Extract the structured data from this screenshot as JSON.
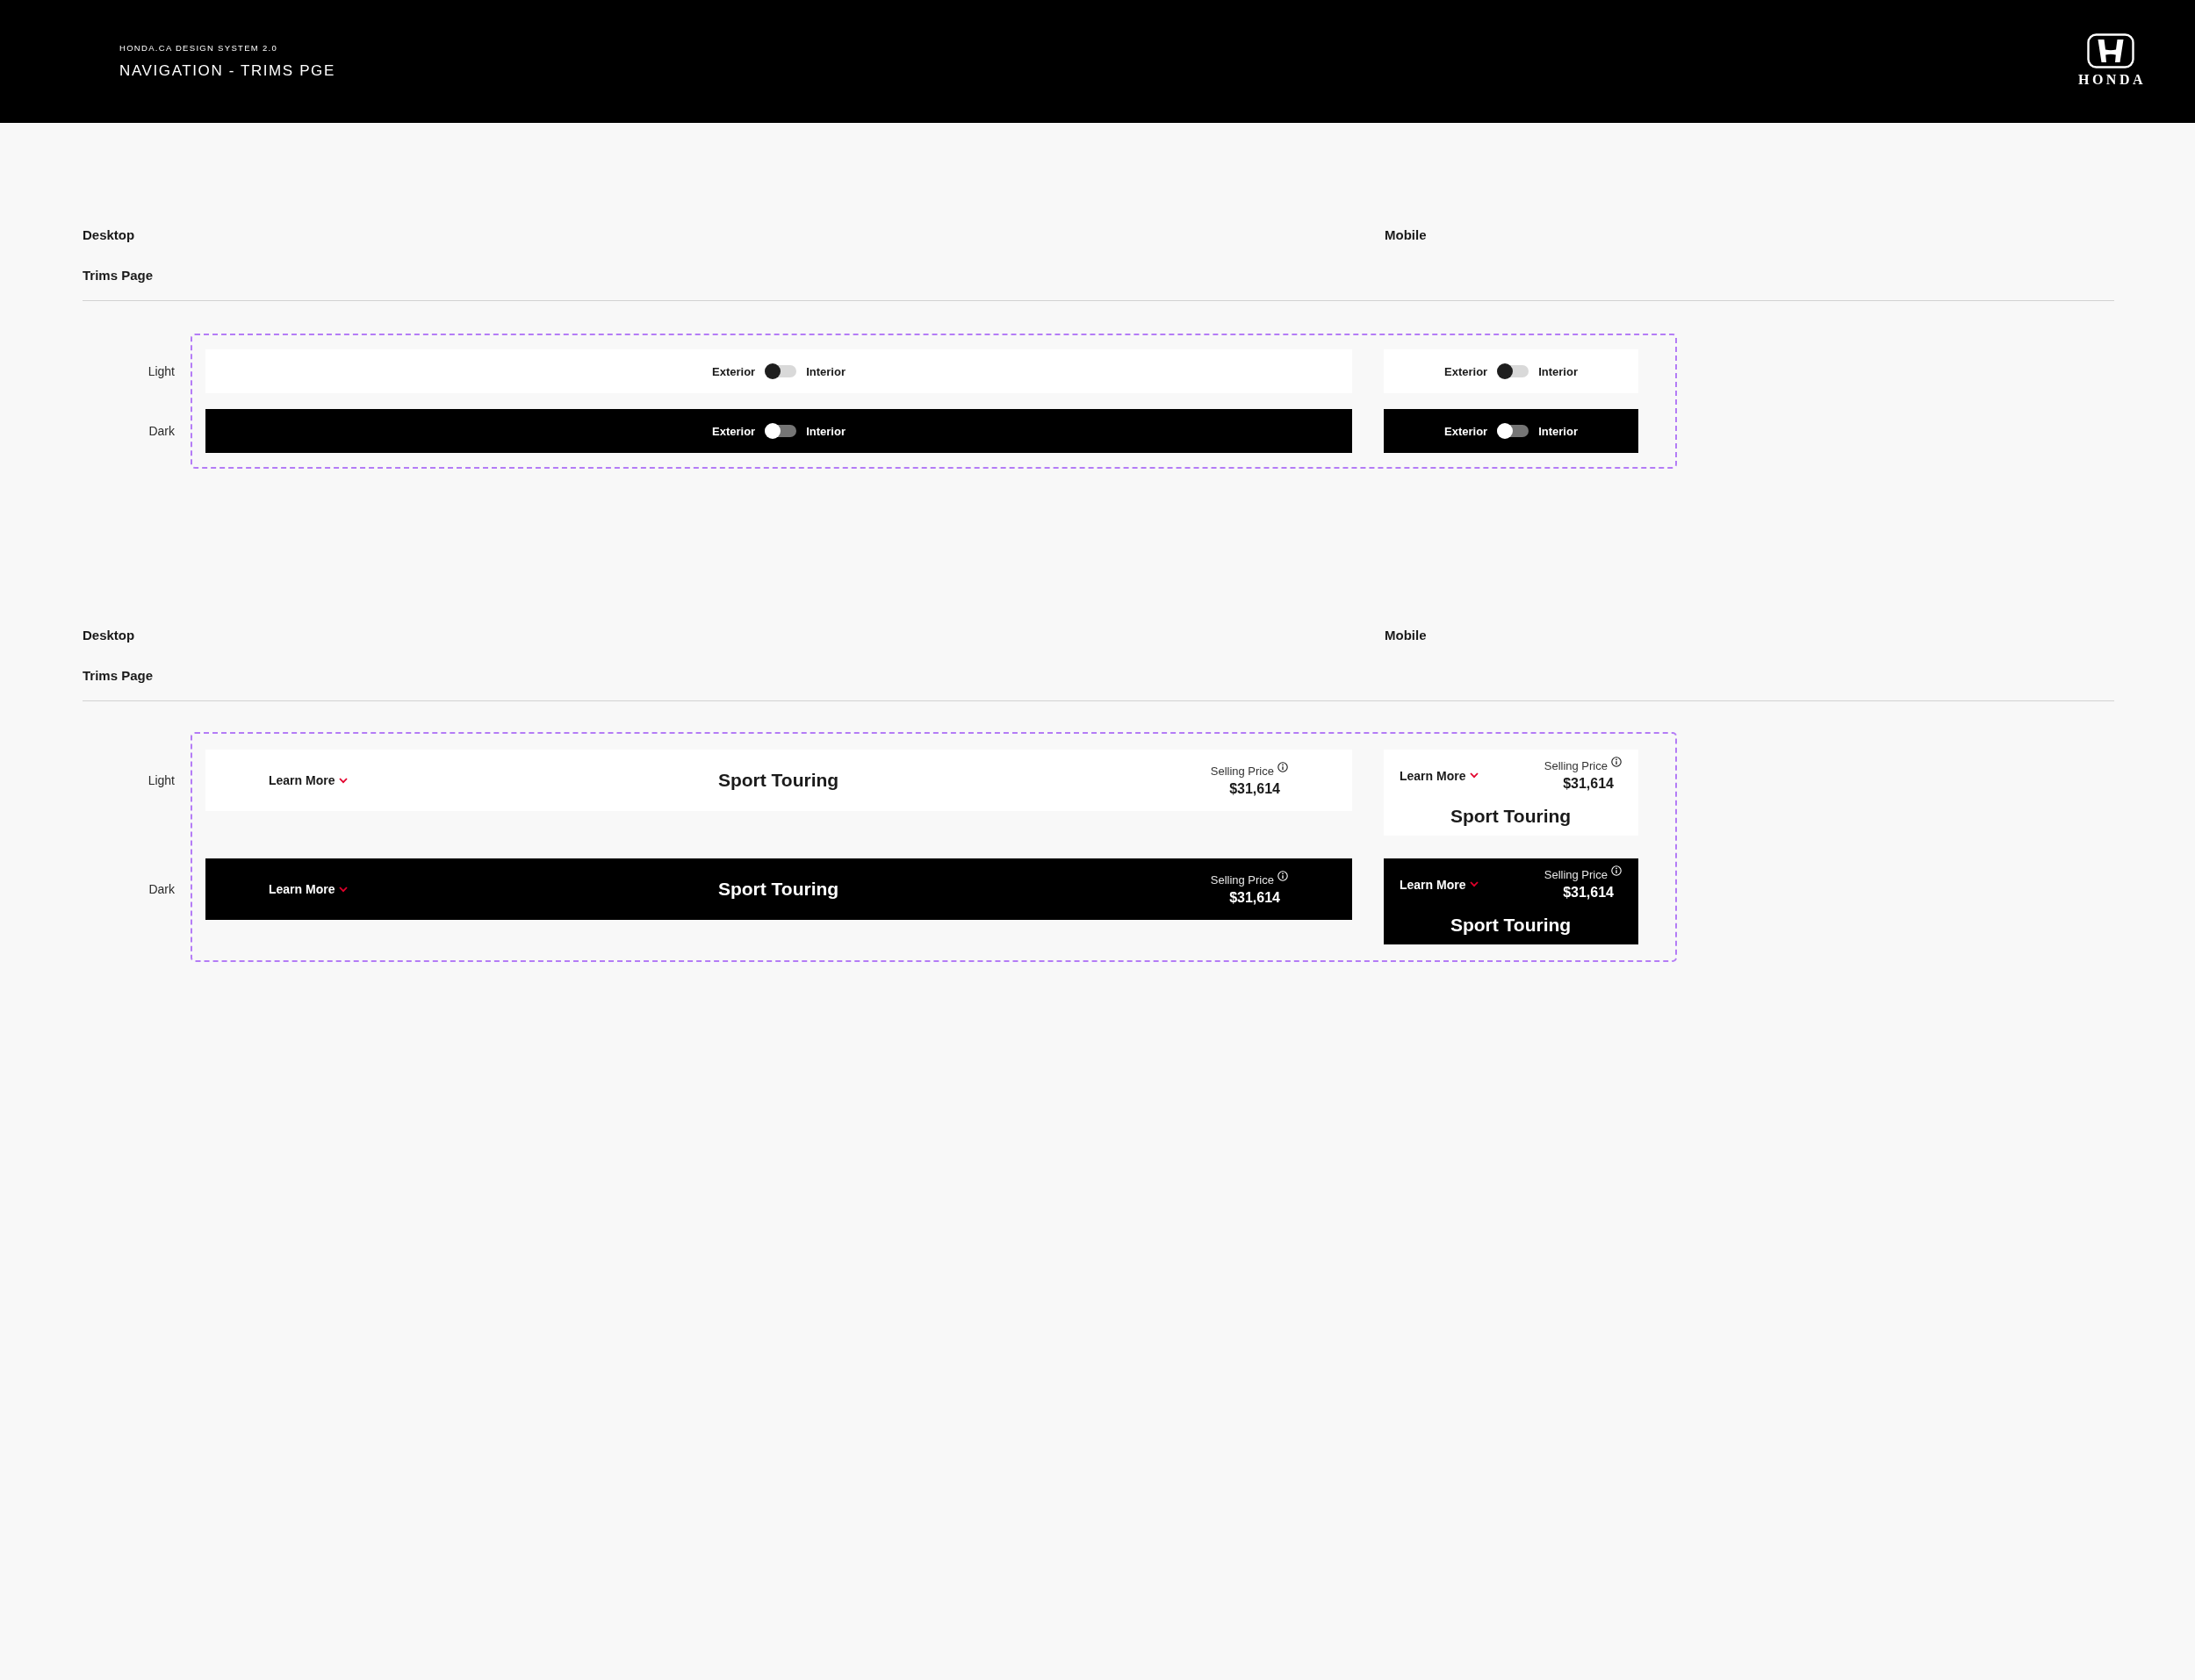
{
  "header": {
    "eyebrow": "HONDA.CA DESIGN SYSTEM 2.0",
    "title": "NAVIGATION - TRIMS PGE",
    "logo_text": "HONDA"
  },
  "sections": [
    {
      "kind": "toggle",
      "desktop_label": "Desktop",
      "mobile_label": "Mobile",
      "page_label": "Trims Page",
      "variants": [
        {
          "label": "Light",
          "kind": "light",
          "desktop": {
            "left": "Exterior",
            "right": "Interior",
            "on": false
          },
          "mobile": {
            "left": "Exterior",
            "right": "Interior",
            "on": false
          }
        },
        {
          "label": "Dark",
          "kind": "dark",
          "desktop": {
            "left": "Exterior",
            "right": "Interior",
            "on": false
          },
          "mobile": {
            "left": "Exterior",
            "right": "Interior",
            "on": false
          }
        }
      ]
    },
    {
      "kind": "trim",
      "desktop_label": "Desktop",
      "mobile_label": "Mobile",
      "page_label": "Trims Page",
      "variants": [
        {
          "label": "Light",
          "kind": "light",
          "desktop": {
            "link": "Learn More",
            "trim": "Sport Touring",
            "price_label": "Selling Price",
            "price": "$31,614"
          },
          "mobile": {
            "link": "Learn More",
            "trim": "Sport Touring",
            "price_label": "Selling Price",
            "price": "$31,614"
          }
        },
        {
          "label": "Dark",
          "kind": "dark",
          "desktop": {
            "link": "Learn More",
            "trim": "Sport Touring",
            "price_label": "Selling Price",
            "price": "$31,614"
          },
          "mobile": {
            "link": "Learn More",
            "trim": "Sport Touring",
            "price_label": "Selling Price",
            "price": "$31,614"
          }
        }
      ]
    }
  ]
}
